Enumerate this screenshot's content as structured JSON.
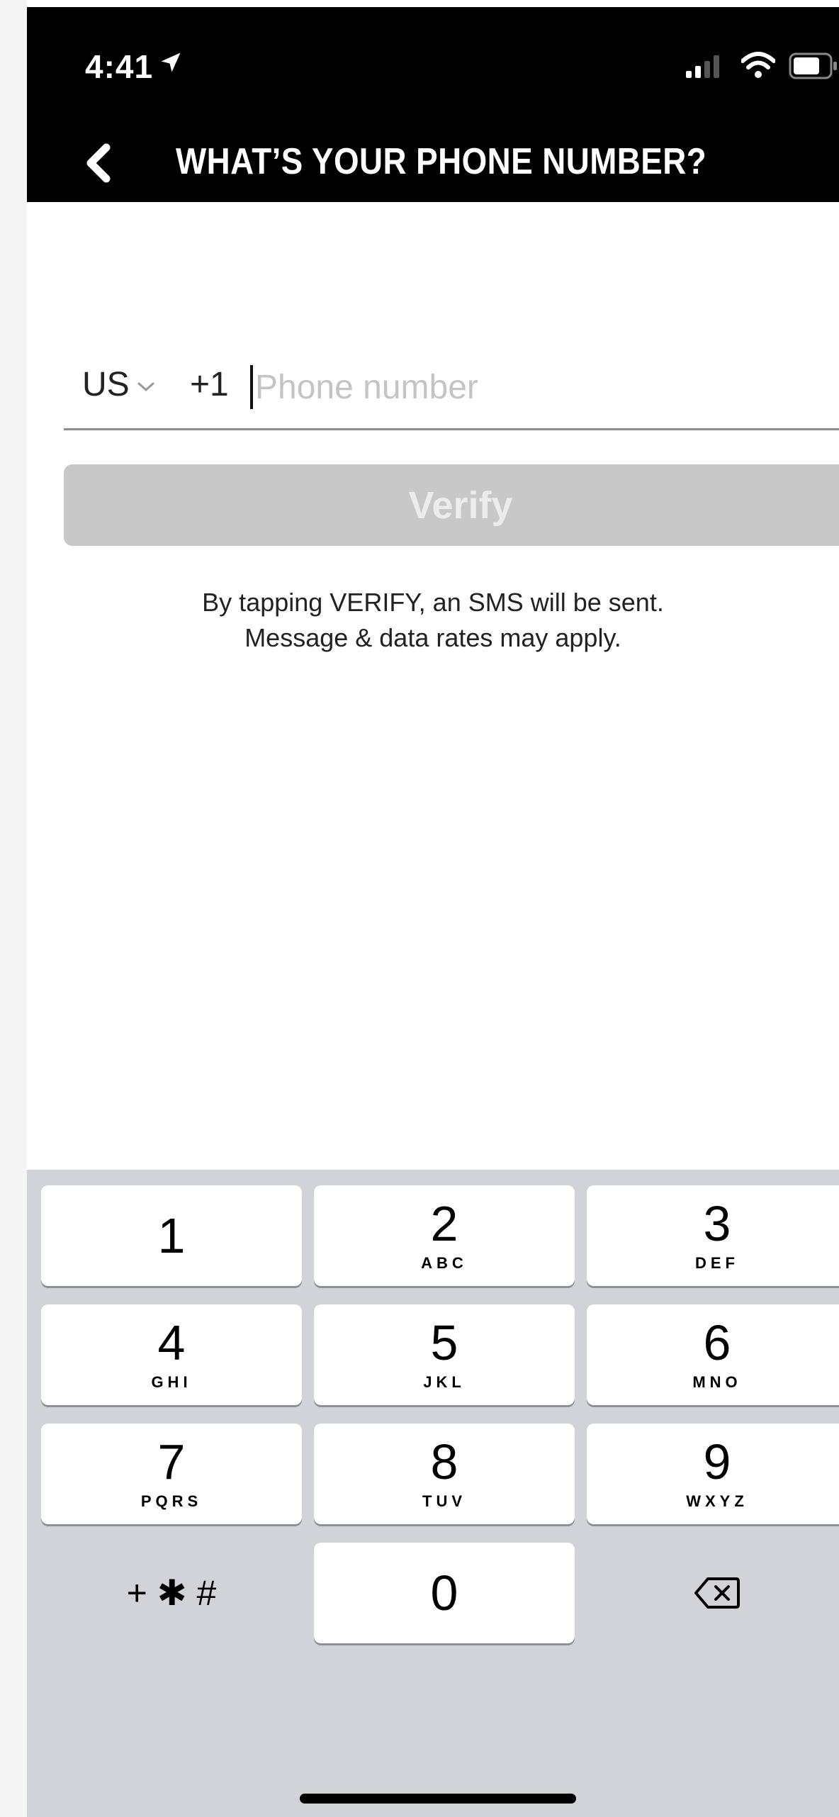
{
  "status_bar": {
    "time": "4:41",
    "icons": [
      "location-arrow-icon",
      "cellular-signal-icon",
      "wifi-icon",
      "battery-icon"
    ]
  },
  "header": {
    "title": "WHAT’S YOUR PHONE NUMBER?",
    "back_icon": "chevron-left-icon"
  },
  "phone_form": {
    "country_code": "US",
    "dial_code": "+1",
    "phone_value": "",
    "phone_placeholder": "Phone number",
    "verify_label": "Verify",
    "disclaimer_line1": "By tapping VERIFY, an SMS will be sent.",
    "disclaimer_line2": "Message & data rates may apply."
  },
  "keypad": {
    "keys": [
      {
        "num": "1",
        "letters": ""
      },
      {
        "num": "2",
        "letters": "ABC"
      },
      {
        "num": "3",
        "letters": "DEF"
      },
      {
        "num": "4",
        "letters": "GHI"
      },
      {
        "num": "5",
        "letters": "JKL"
      },
      {
        "num": "6",
        "letters": "MNO"
      },
      {
        "num": "7",
        "letters": "PQRS"
      },
      {
        "num": "8",
        "letters": "TUV"
      },
      {
        "num": "9",
        "letters": "WXYZ"
      },
      {
        "num": "0",
        "letters": ""
      }
    ],
    "symbols_label": "+ ✱ #",
    "delete_icon": "backspace-icon"
  },
  "colors": {
    "header_bg": "#000000",
    "button_disabled": "#c8c8c8",
    "keypad_bg": "#d1d3d9"
  }
}
